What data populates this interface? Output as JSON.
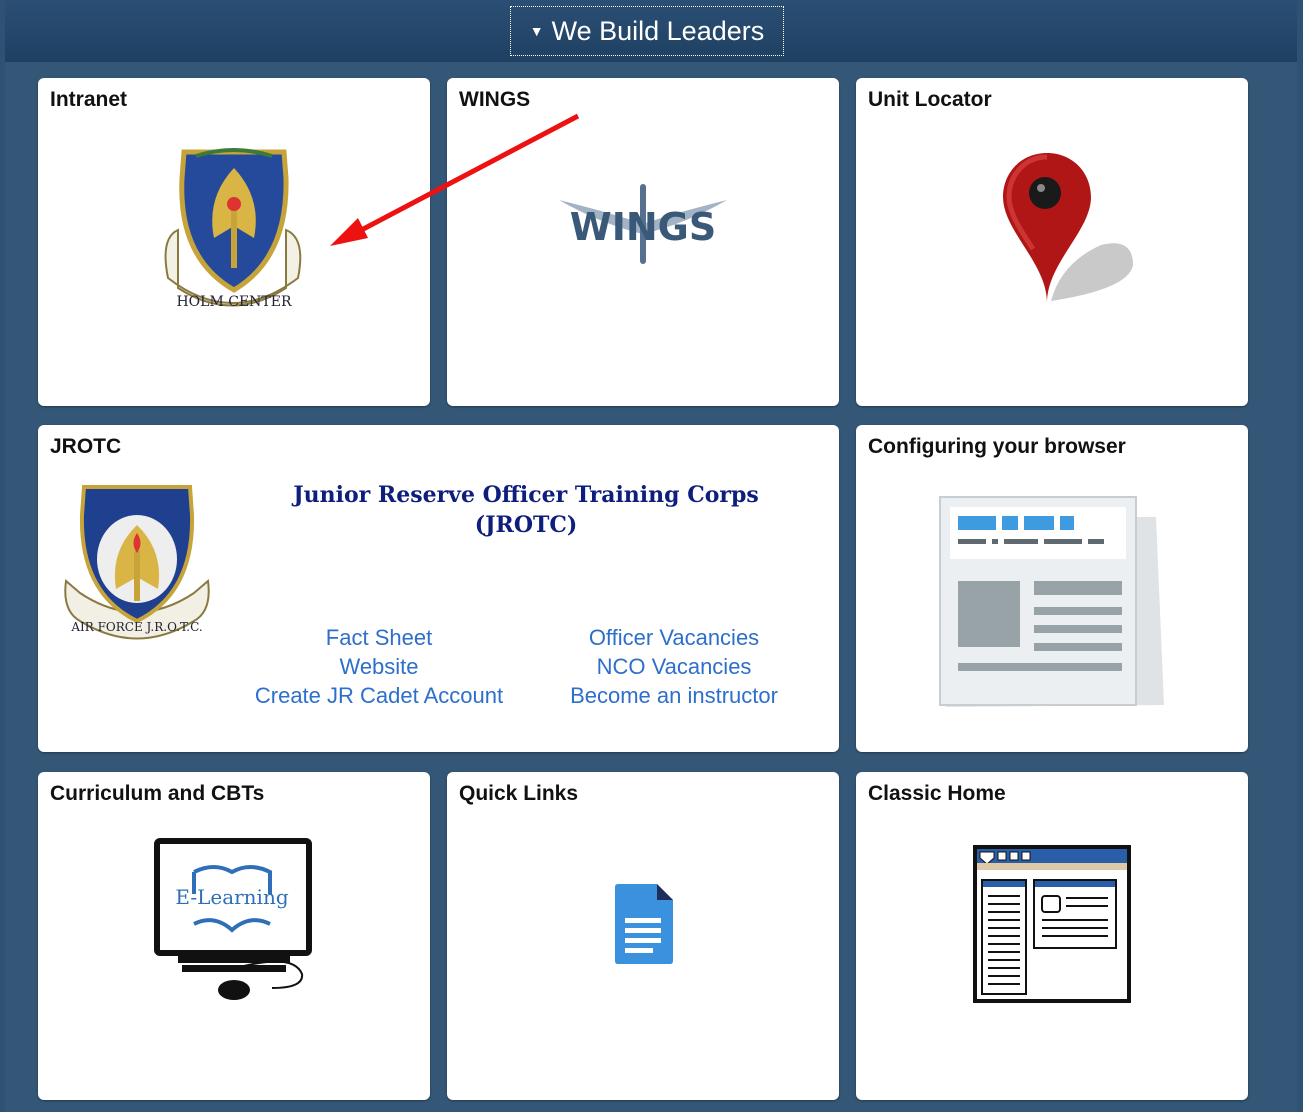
{
  "header": {
    "title": "We Build Leaders",
    "collapse_icon": "triangle-down-icon"
  },
  "tiles": {
    "intranet": {
      "title": "Intranet",
      "icon": "holm-center-emblem-icon",
      "emblem_text": "HOLM CENTER"
    },
    "wings": {
      "title": "WINGS",
      "icon": "wings-logo-icon",
      "logo_text": "WINGS"
    },
    "unit_locator": {
      "title": "Unit Locator",
      "icon": "map-pin-icon"
    },
    "jrotc": {
      "title": "JROTC",
      "icon": "af-jrotc-emblem-icon",
      "emblem_text": "AIR FORCE J.R.O.T.C.",
      "heading_line1": "Junior Reserve Officer Training Corps",
      "heading_line2": "(JROTC)",
      "links_left": [
        "Fact Sheet",
        "Website",
        "Create JR Cadet Account"
      ],
      "links_right": [
        "Officer Vacancies",
        "NCO Vacancies",
        "Become an instructor"
      ]
    },
    "configuring": {
      "title": "Configuring your browser",
      "icon": "newspaper-icon"
    },
    "curriculum": {
      "title": "Curriculum and CBTs",
      "icon": "e-learning-monitor-icon",
      "screen_text": "E-Learning"
    },
    "quick_links": {
      "title": "Quick Links",
      "icon": "document-icon"
    },
    "classic_home": {
      "title": "Classic Home",
      "icon": "classic-home-page-icon"
    }
  },
  "annotation": {
    "icon": "red-arrow-icon",
    "color": "#ee1111"
  },
  "colors": {
    "background": "#2f5173",
    "header": "#1e4062",
    "link": "#2d6fca",
    "jrotc_heading": "#0d1e7c"
  }
}
